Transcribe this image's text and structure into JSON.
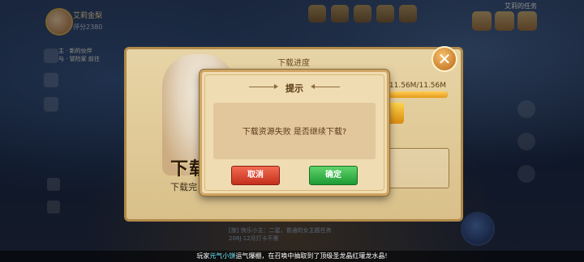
{
  "player": {
    "name": "艾莉金梨",
    "score": "评分2380"
  },
  "quest": {
    "line1": "主 · 新的伙伴",
    "line2": "与 · 冒险家 前往"
  },
  "right_tag": "艾莉的任务",
  "download_panel": {
    "title": "下载进度",
    "progress_text": "11.56M/11.56M",
    "progress": 1.0,
    "banner": "下载",
    "banner_sub": "下载完"
  },
  "dialog": {
    "title": "提示",
    "message": "下载资源失败 是否继续下载?",
    "cancel": "取消",
    "confirm": "确定"
  },
  "chat": {
    "line1": "[旅] 快乐小主：二星，普通的女主题任务",
    "line2": "208J 12月打卡不需"
  },
  "ticker": {
    "prefix": "玩家",
    "player": "元气小饼",
    "suffix": "运气爆棚，在召唤中抽取到了顶级圣龙晶红瓘龙水晶!"
  },
  "icons": {
    "close": "close-icon"
  }
}
